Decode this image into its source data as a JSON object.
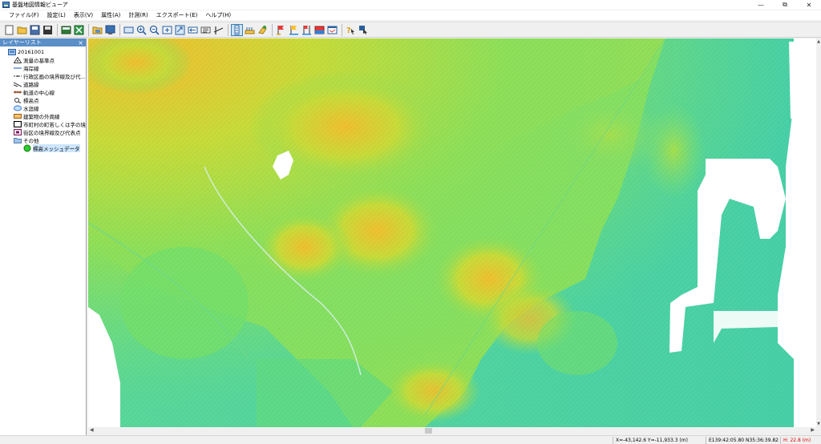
{
  "window": {
    "title": "基盤地図情報ビューア",
    "min_symbol": "—",
    "max_symbol": "⧉",
    "close_symbol": "✕"
  },
  "menu": [
    "ファイル(F)",
    "設定(L)",
    "表示(V)",
    "属性(A)",
    "計測(R)",
    "エクスポート(E)",
    "ヘルプ(H)"
  ],
  "toolbar": {
    "icons": [
      "new-icon",
      "open-icon",
      "save-icon",
      "save-as-icon",
      "export-image-icon",
      "export-sheet-icon",
      "print-icon",
      "print-preview-icon",
      "full-extent-icon",
      "zoom-in-icon",
      "zoom-out-icon",
      "zoom-window-icon",
      "zoom-prev-icon",
      "pan-icon",
      "layer-list-icon",
      "measure-line-icon",
      "select-tool-icon",
      "ruler-icon",
      "paint-icon",
      "flag-red-icon",
      "flag-yellow-icon",
      "flag-compare-icon",
      "flag-chart-icon",
      "window-icon",
      "image-icon",
      "help-pointer-icon",
      "info-pointer-icon"
    ],
    "active": "select-tool-icon"
  },
  "panel": {
    "title": "レイヤーリスト",
    "close_symbol": "×",
    "root": "20161001",
    "layers": [
      {
        "label": "測量の基準点",
        "icon": "triangle-point-icon"
      },
      {
        "label": "海岸線",
        "icon": "coastline-icon"
      },
      {
        "label": "行政区画の境界線及び代...",
        "icon": "boundary-line-icon"
      },
      {
        "label": "道路縁",
        "icon": "road-edge-icon"
      },
      {
        "label": "軌道の中心線",
        "icon": "railway-icon"
      },
      {
        "label": "標高点",
        "icon": "elevation-point-icon"
      },
      {
        "label": "水涯線",
        "icon": "water-line-icon"
      },
      {
        "label": "建築物の外周線",
        "icon": "building-icon"
      },
      {
        "label": "市町村の町若しくは字の境...",
        "icon": "town-boundary-icon"
      },
      {
        "label": "街区の境界線及び代表点",
        "icon": "block-boundary-icon"
      },
      {
        "label": "その他",
        "icon": "folder-icon"
      }
    ],
    "sublayer": {
      "label": "標高メッシュデータ",
      "icon": "green-circle-icon"
    }
  },
  "status": {
    "coords": "X=-43,142.6 Y=-11,933.3 (m)",
    "latlon": "E139:42:05.80 N35:36:39.82",
    "height": "H: 22.8 (m)"
  },
  "colors": {
    "panel_header": "#5a8fc8",
    "low_elevation": "#55d8a0",
    "mid_elevation": "#8ee05a",
    "high_elevation": "#f0c030",
    "peak_elevation": "#e89a30",
    "nodata": "#ffffff"
  }
}
